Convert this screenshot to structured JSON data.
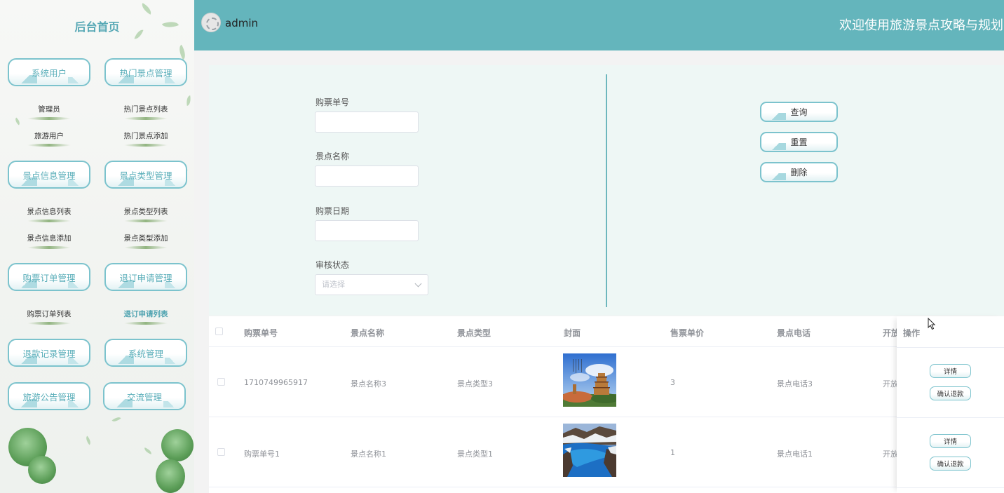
{
  "sidebar": {
    "title": "后台首页",
    "groups": [
      {
        "label": "系统用户",
        "items": [
          "管理员",
          "旅游用户"
        ]
      },
      {
        "label": "热门景点管理",
        "items": [
          "热门景点列表",
          "热门景点添加"
        ]
      },
      {
        "label": "景点信息管理",
        "items": [
          "景点信息列表",
          "景点信息添加"
        ]
      },
      {
        "label": "景点类型管理",
        "items": [
          "景点类型列表",
          "景点类型添加"
        ]
      },
      {
        "label": "购票订单管理",
        "items": [
          "购票订单列表"
        ]
      },
      {
        "label": "退订申请管理",
        "items": [
          "退订申请列表"
        ]
      },
      {
        "label": "退款记录管理",
        "items": []
      },
      {
        "label": "系统管理",
        "items": []
      },
      {
        "label": "旅游公告管理",
        "items": []
      },
      {
        "label": "交流管理",
        "items": []
      }
    ],
    "active_item": "退订申请列表"
  },
  "header": {
    "username": "admin",
    "welcome": "欢迎使用旅游景点攻略与规划系"
  },
  "search": {
    "fields": [
      {
        "label": "购票单号",
        "value": ""
      },
      {
        "label": "景点名称",
        "value": ""
      },
      {
        "label": "购票日期",
        "value": ""
      }
    ],
    "status_label": "审核状态",
    "status_placeholder": "请选择",
    "buttons": {
      "query": "查询",
      "reset": "重置",
      "delete": "删除"
    }
  },
  "table": {
    "columns": [
      "购票单号",
      "景点名称",
      "景点类型",
      "封面",
      "售票单价",
      "景点电话",
      "开放",
      "操作"
    ],
    "rows": [
      {
        "order_no": "1710749965917",
        "name": "景点名称3",
        "type": "景点类型3",
        "price": "3",
        "phone": "景点电话3",
        "open": "开放"
      },
      {
        "order_no": "购票单号1",
        "name": "景点名称1",
        "type": "景点类型1",
        "price": "1",
        "phone": "景点电话1",
        "open": "开放"
      }
    ],
    "row_actions": {
      "detail": "详情",
      "refund": "确认退款"
    }
  },
  "colors": {
    "accent": "#64b5bc",
    "panel": "#eef7f5",
    "button_border": "#7cc3cd"
  }
}
